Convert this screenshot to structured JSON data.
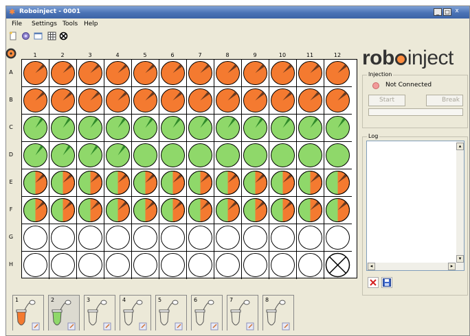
{
  "window": {
    "title": "Roboinject - 0001",
    "controls": {
      "minimize": "_",
      "maximize": "□",
      "close": "x"
    }
  },
  "menu": [
    "File",
    "Settings",
    "Tools",
    "Help"
  ],
  "toolbar": [
    "new-file-icon",
    "settings-gear-icon",
    "single-view-icon",
    "grid-view-icon",
    "clear-circle-icon"
  ],
  "plate": {
    "columns": [
      "1",
      "2",
      "3",
      "4",
      "5",
      "6",
      "7",
      "8",
      "9",
      "10",
      "11",
      "12"
    ],
    "rows": [
      "A",
      "B",
      "C",
      "D",
      "E",
      "F",
      "G",
      "H"
    ],
    "well_legend": {
      "orange": "orange filled well with dark wedge",
      "green": "green filled well with dark wedge",
      "green_plain": "green filled well",
      "half": "half green half orange with wedge",
      "empty": "empty well",
      "blocked": "crossed well"
    },
    "well_states": [
      [
        "orange",
        "orange",
        "orange",
        "orange",
        "orange",
        "orange",
        "orange",
        "orange",
        "orange",
        "orange",
        "orange",
        "orange"
      ],
      [
        "orange",
        "orange",
        "orange",
        "orange",
        "orange",
        "orange",
        "orange",
        "orange",
        "orange",
        "orange",
        "orange",
        "orange"
      ],
      [
        "green",
        "green",
        "green",
        "green",
        "green",
        "green",
        "green",
        "green",
        "green",
        "green",
        "green",
        "green"
      ],
      [
        "green",
        "green",
        "green",
        "green",
        "green_plain",
        "green_plain",
        "green_plain",
        "green_plain",
        "green_plain",
        "green_plain",
        "green_plain",
        "green_plain"
      ],
      [
        "half",
        "half",
        "half",
        "half",
        "half",
        "half",
        "half",
        "half",
        "half",
        "half",
        "half",
        "half"
      ],
      [
        "half",
        "half",
        "half",
        "half",
        "half",
        "half",
        "half",
        "half",
        "half",
        "half",
        "half",
        "half"
      ],
      [
        "empty",
        "empty",
        "empty",
        "empty",
        "empty",
        "empty",
        "empty",
        "empty",
        "empty",
        "empty",
        "empty",
        "empty"
      ],
      [
        "empty",
        "empty",
        "empty",
        "empty",
        "empty",
        "empty",
        "empty",
        "empty",
        "empty",
        "empty",
        "empty",
        "blocked"
      ]
    ]
  },
  "logo": {
    "part1": "rob",
    "part2": "inject"
  },
  "injection": {
    "group_title": "Injection",
    "status": "Not Connected",
    "start_label": "Start",
    "break_label": "Break"
  },
  "log": {
    "group_title": "Log",
    "entries": []
  },
  "tubes": [
    {
      "num": "1",
      "fill": "orange"
    },
    {
      "num": "2",
      "fill": "green"
    },
    {
      "num": "3",
      "fill": "empty"
    },
    {
      "num": "4",
      "fill": "empty"
    },
    {
      "num": "5",
      "fill": "empty"
    },
    {
      "num": "6",
      "fill": "empty"
    },
    {
      "num": "7",
      "fill": "empty"
    },
    {
      "num": "8",
      "fill": "empty"
    }
  ],
  "colors": {
    "orange": "#f47a30",
    "green": "#8fd86a",
    "wedge": "#6b3a1f",
    "title_bar": "#4a72b5"
  }
}
